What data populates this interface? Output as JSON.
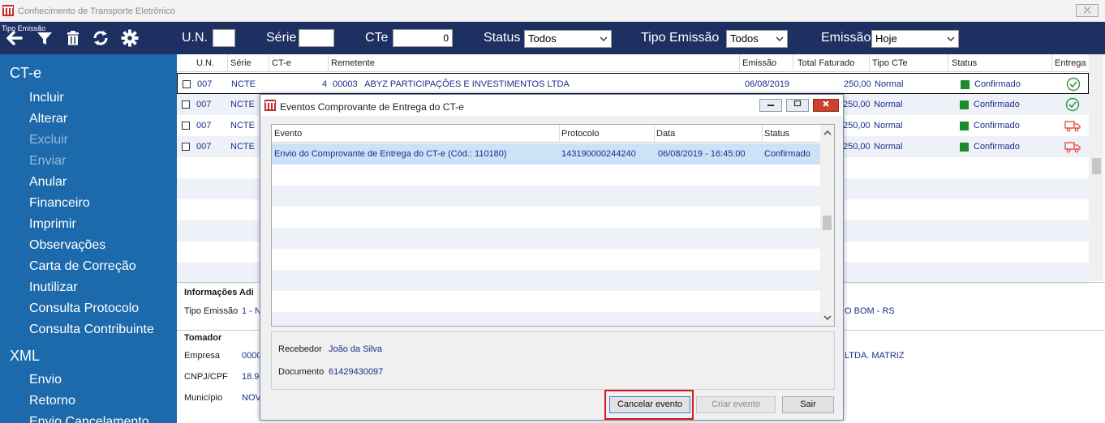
{
  "window": {
    "title": "Conhecimento de Transporte Eletrônico",
    "close_label": "⤫"
  },
  "toolbar": {
    "tiny_label": "Tipo Emissão",
    "un_label": "U.N.",
    "un_value": "",
    "serie_label": "Série",
    "serie_value": "",
    "cte_label": "CTe",
    "cte_value": "0",
    "status_label": "Status",
    "status_value": "Todos",
    "tipo_label": "Tipo Emissão",
    "tipo_value": "Todos",
    "emissao_label": "Emissão",
    "emissao_value": "Hoje"
  },
  "sidebar": {
    "section_cte": "CT-e",
    "items": [
      "Incluir",
      "Alterar",
      "Excluir",
      "Enviar",
      "Anular",
      "Financeiro",
      "Imprimir",
      "Observações",
      "Carta de Correção",
      "Inutilizar",
      "Consulta Protocolo",
      "Consulta Contribuinte"
    ],
    "section_xml": "XML",
    "xml_items": [
      "Envio",
      "Retorno",
      "Envio Cancelamento"
    ]
  },
  "grid": {
    "headers": [
      "U.N.",
      "Série",
      "CT-e",
      "Remetente",
      "Emissão",
      "Total Faturado",
      "Tipo CTe",
      "Status",
      "Entrega"
    ],
    "rows": [
      {
        "un": "007",
        "serie": "NCTE",
        "cte": "4",
        "remetente": "00003   ABYZ PARTICIPAÇÕES E INVESTIMENTOS LTDA",
        "emissao": "06/08/2019",
        "total": "250,00",
        "tipo": "Normal",
        "status": "Confirmado",
        "entrega": "check-circle-icon"
      },
      {
        "un": "007",
        "serie": "NCTE",
        "cte": "",
        "remetente": "",
        "emissao": "",
        "total": "250,00",
        "tipo": "Normal",
        "status": "Confirmado",
        "entrega": "check-circle-icon"
      },
      {
        "un": "007",
        "serie": "NCTE",
        "cte": "",
        "remetente": "",
        "emissao": "",
        "total": "250,00",
        "tipo": "Normal",
        "status": "Confirmado",
        "entrega": "truck-icon"
      },
      {
        "un": "007",
        "serie": "NCTE",
        "cte": "",
        "remetente": "",
        "emissao": "",
        "total": "250,00",
        "tipo": "Normal",
        "status": "Confirmado",
        "entrega": "truck-icon"
      }
    ]
  },
  "info": {
    "title_adicionais": "Informações Adi",
    "tipo_emissao_label": "Tipo Emissão",
    "tipo_emissao_value": "1 - N",
    "city_fragment": "O BOM - RS",
    "title_tomador": "Tomador",
    "empresa_label": "Empresa",
    "empresa_value": "0000",
    "empresa_fragment": "LTDA. MATRIZ",
    "cnpj_label": "CNPJ/CPF",
    "cnpj_value": "18.9",
    "municipio_label": "Município",
    "municipio_value": "NOV"
  },
  "dialog": {
    "title": "Eventos Comprovante de Entrega do CT-e",
    "headers": [
      "Evento",
      "Protocolo",
      "Data",
      "Status"
    ],
    "rows": [
      {
        "evento": "Envio do Comprovante de Entrega do CT-e (Cód.: 110180)",
        "protocolo": "143190000244240",
        "data": "06/08/2019 - 16:45:00",
        "status": "Confirmado"
      }
    ],
    "recebedor_label": "Recebedor",
    "recebedor_value": "João da Silva",
    "documento_label": "Documento",
    "documento_value": "61429430097",
    "btn_cancelar": "Cancelar evento",
    "btn_criar": "Criar evento",
    "btn_sair": "Sair"
  },
  "colors": {
    "toolbar": "#1e3061",
    "sidebar": "#1c6aac",
    "status_green": "#1d8a2e",
    "highlight": "#d81a1a"
  }
}
